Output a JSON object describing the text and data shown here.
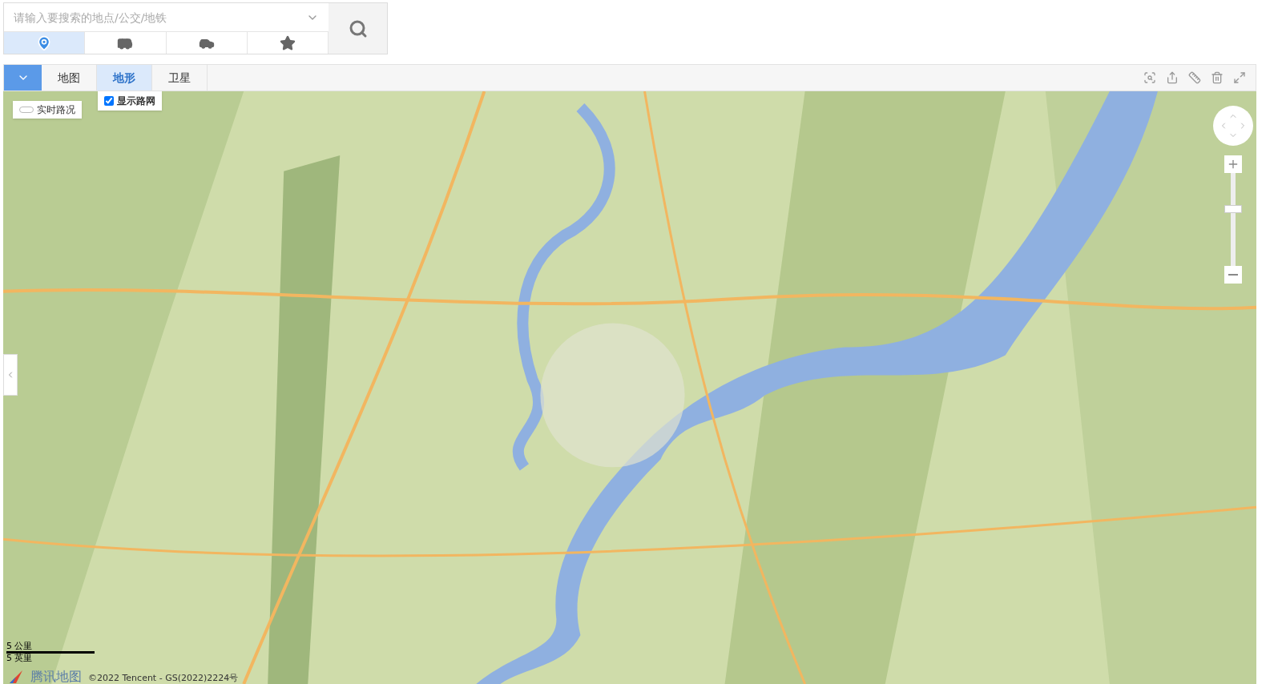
{
  "search": {
    "placeholder": "请输入要搜索的地点/公交/地铁",
    "modes": [
      {
        "kind": "place",
        "selected": true
      },
      {
        "kind": "bus",
        "selected": false
      },
      {
        "kind": "car",
        "selected": false
      },
      {
        "kind": "favorite",
        "selected": false
      }
    ]
  },
  "map_types": [
    {
      "label": "地图",
      "selected": false
    },
    {
      "label": "地形",
      "selected": true
    },
    {
      "label": "卫星",
      "selected": false
    }
  ],
  "traffic": {
    "label": "实时路况"
  },
  "road_network": {
    "label": "显示路网",
    "checked": true
  },
  "zoom": {
    "level": 0.62
  },
  "scale": {
    "metric": "5 公里",
    "imperial": "5 英里"
  },
  "logo": {
    "text": "腾讯地图"
  },
  "copyright": "©2022 Tencent - GS(2022)2224号"
}
